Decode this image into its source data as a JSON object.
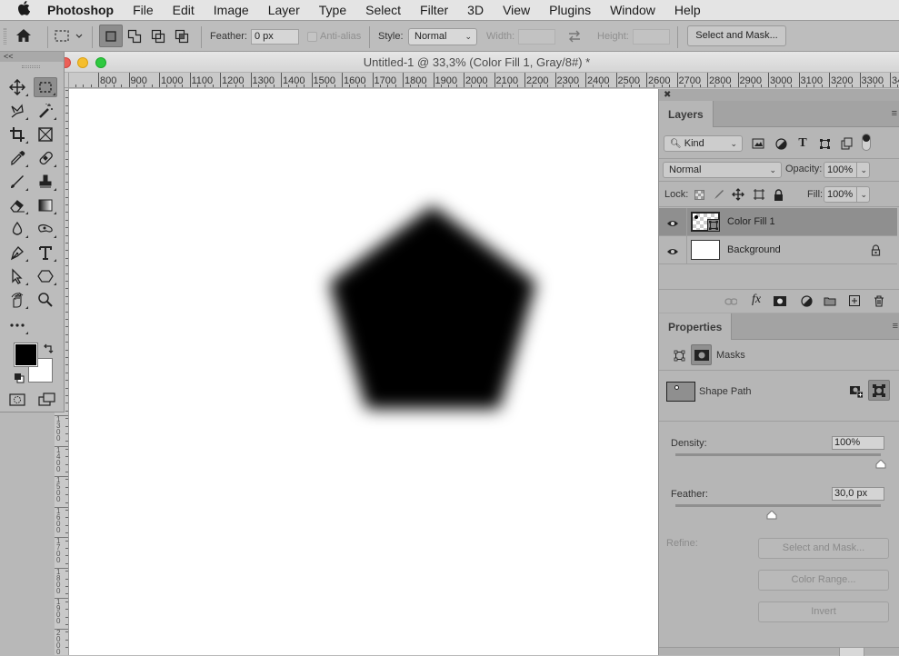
{
  "menubar": {
    "apple_icon": "apple-logo",
    "app_name": "Photoshop",
    "items": [
      "File",
      "Edit",
      "Image",
      "Layer",
      "Type",
      "Select",
      "Filter",
      "3D",
      "View",
      "Plugins",
      "Window",
      "Help"
    ]
  },
  "options_bar": {
    "home_icon": "home-icon",
    "tool_preset_icon": "rectangular-marquee-icon",
    "selection_modes": [
      "new-selection",
      "add-to-selection",
      "subtract-from-selection",
      "intersect-with-selection"
    ],
    "active_mode": "new-selection",
    "feather_label": "Feather:",
    "feather_value": "0 px",
    "anti_alias_label": "Anti-alias",
    "anti_alias_checked": false,
    "style_label": "Style:",
    "style_value": "Normal",
    "width_label": "Width:",
    "width_value": "",
    "height_label": "Height:",
    "height_value": "",
    "select_and_mask_label": "Select and Mask..."
  },
  "toolbox": {
    "collapse_label": "<<",
    "tools": [
      {
        "name": "move-tool",
        "selected": false
      },
      {
        "name": "rectangular-marquee-tool",
        "selected": true
      },
      {
        "name": "lasso-tool",
        "selected": false
      },
      {
        "name": "magic-wand-tool",
        "selected": false
      },
      {
        "name": "crop-tool",
        "selected": false
      },
      {
        "name": "frame-tool",
        "selected": false
      },
      {
        "name": "eyedropper-tool",
        "selected": false
      },
      {
        "name": "healing-brush-tool",
        "selected": false
      },
      {
        "name": "brush-tool",
        "selected": false
      },
      {
        "name": "clone-stamp-tool",
        "selected": false
      },
      {
        "name": "eraser-tool",
        "selected": false
      },
      {
        "name": "gradient-tool",
        "selected": false
      },
      {
        "name": "blur-tool",
        "selected": false
      },
      {
        "name": "smudge-tool",
        "selected": false
      },
      {
        "name": "pen-tool",
        "selected": false
      },
      {
        "name": "type-tool",
        "selected": false
      },
      {
        "name": "path-selection-tool",
        "selected": false
      },
      {
        "name": "polygon-shape-tool",
        "selected": false
      },
      {
        "name": "rotate-view-tool",
        "selected": false
      },
      {
        "name": "zoom-tool",
        "selected": false
      },
      {
        "name": "edit-toolbar",
        "selected": false
      }
    ],
    "foreground_color": "#000000",
    "background_color": "#ffffff"
  },
  "document": {
    "title": "Untitled-1 @ 33,3% (Color Fill 1, Gray/8#) *",
    "zoom": "33,3%",
    "h_ruler_labels": [
      "800",
      "900",
      "1000",
      "1100",
      "1200",
      "1300",
      "1400",
      "1500",
      "1600",
      "1700",
      "1800",
      "1900",
      "2000",
      "2100",
      "2200",
      "2300",
      "2400",
      "2500",
      "2600",
      "2700",
      "2800",
      "2900",
      "3000",
      "3100",
      "3200",
      "3300",
      "34"
    ],
    "v_ruler_labels": [
      "1300",
      "1400",
      "1500",
      "1600",
      "1700",
      "1800",
      "1900",
      "2000"
    ],
    "shape": {
      "type": "pentagon",
      "color": "#000000",
      "feathered": true
    }
  },
  "layers_panel": {
    "tab_label": "Layers",
    "filter_kind": "Kind",
    "blend_mode": "Normal",
    "opacity_label": "Opacity:",
    "opacity_value": "100%",
    "lock_label": "Lock:",
    "fill_label": "Fill:",
    "fill_value": "100%",
    "layers": [
      {
        "name": "Color Fill 1",
        "visible": true,
        "selected": true,
        "locked": false
      },
      {
        "name": "Background",
        "visible": true,
        "selected": false,
        "locked": true
      }
    ],
    "footer_icons": [
      "link-layers-icon",
      "fx-icon",
      "add-mask-icon",
      "adjustment-layer-icon",
      "new-group-icon",
      "new-layer-icon",
      "delete-layer-icon"
    ]
  },
  "properties_panel": {
    "tab_label": "Properties",
    "section_label": "Masks",
    "mask_row_label": "Shape Path",
    "density_label": "Density:",
    "density_value": "100%",
    "density_fraction": 1.0,
    "feather_label": "Feather:",
    "feather_value": "30,0 px",
    "feather_fraction": 0.47,
    "refine_label": "Refine:",
    "select_and_mask_label": "Select and Mask...",
    "color_range_label": "Color Range...",
    "invert_label": "Invert"
  }
}
